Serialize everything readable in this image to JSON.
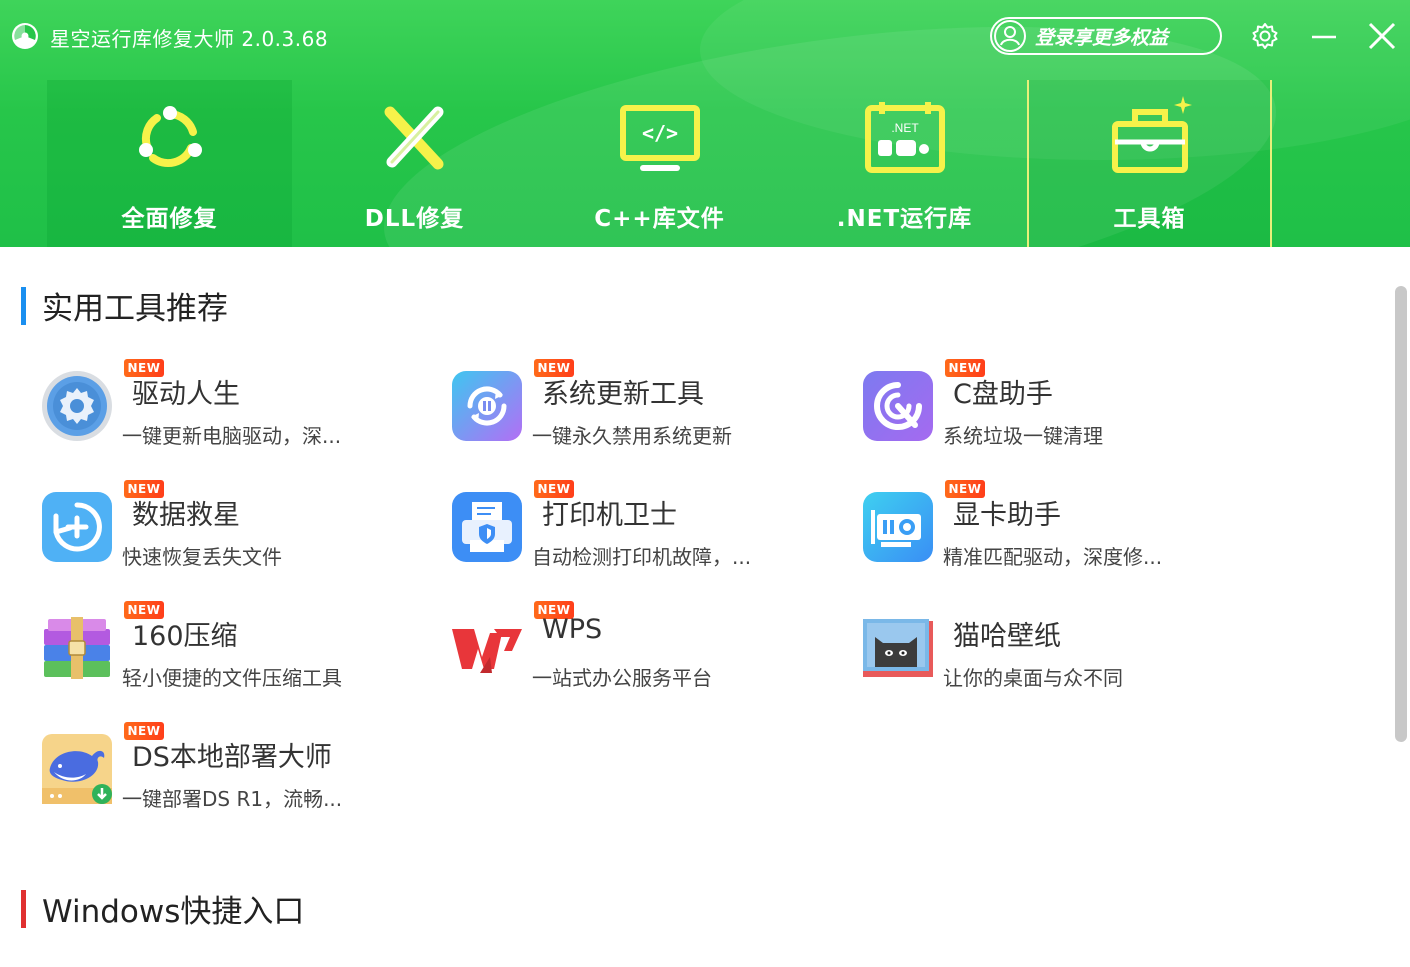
{
  "app": {
    "title": "星空运行库修复大师 2.0.3.68"
  },
  "header": {
    "login_label": "登录享更多权益"
  },
  "nav": [
    {
      "label": "全面修复",
      "icon": "repair-cycle-icon"
    },
    {
      "label": "DLL修复",
      "icon": "dll-tools-icon"
    },
    {
      "label": "C++库文件",
      "icon": "code-monitor-icon"
    },
    {
      "label": ".NET运行库",
      "icon": "dotnet-calendar-icon"
    },
    {
      "label": "工具箱",
      "icon": "toolbox-icon"
    }
  ],
  "sections": {
    "tools": "实用工具推荐",
    "windows": "Windows快捷入口"
  },
  "badge": "NEW",
  "tools": [
    {
      "name": "驱动人生",
      "desc": "一键更新电脑驱动，深...",
      "new": true,
      "icon": "gear-icon"
    },
    {
      "name": "系统更新工具",
      "desc": "一键永久禁用系统更新",
      "new": true,
      "icon": "update-pause-icon"
    },
    {
      "name": "C盘助手",
      "desc": "系统垃圾一键清理",
      "new": true,
      "icon": "disk-cleaner-icon"
    },
    {
      "name": "数据救星",
      "desc": "快速恢复丢失文件",
      "new": true,
      "icon": "data-restore-icon"
    },
    {
      "name": "打印机卫士",
      "desc": "自动检测打印机故障，...",
      "new": true,
      "icon": "printer-shield-icon"
    },
    {
      "name": "显卡助手",
      "desc": "精准匹配驱动，深度修...",
      "new": true,
      "icon": "graphics-card-icon"
    },
    {
      "name": "160压缩",
      "desc": "轻小便捷的文件压缩工具",
      "new": true,
      "icon": "archive-books-icon"
    },
    {
      "name": "WPS",
      "desc": "一站式办公服务平台",
      "new": true,
      "icon": "wps-logo-icon"
    },
    {
      "name": "猫哈壁纸",
      "desc": "让你的桌面与众不同",
      "new": false,
      "icon": "cat-wallpaper-icon"
    },
    {
      "name": "DS本地部署大师",
      "desc": "一键部署DS R1，流畅...",
      "new": true,
      "icon": "whale-deploy-icon"
    }
  ],
  "colors": {
    "header_green": "#27c64a",
    "section_blue": "#1a8ff0",
    "section_red": "#e03030",
    "badge_orange": "#ff5a1a"
  }
}
